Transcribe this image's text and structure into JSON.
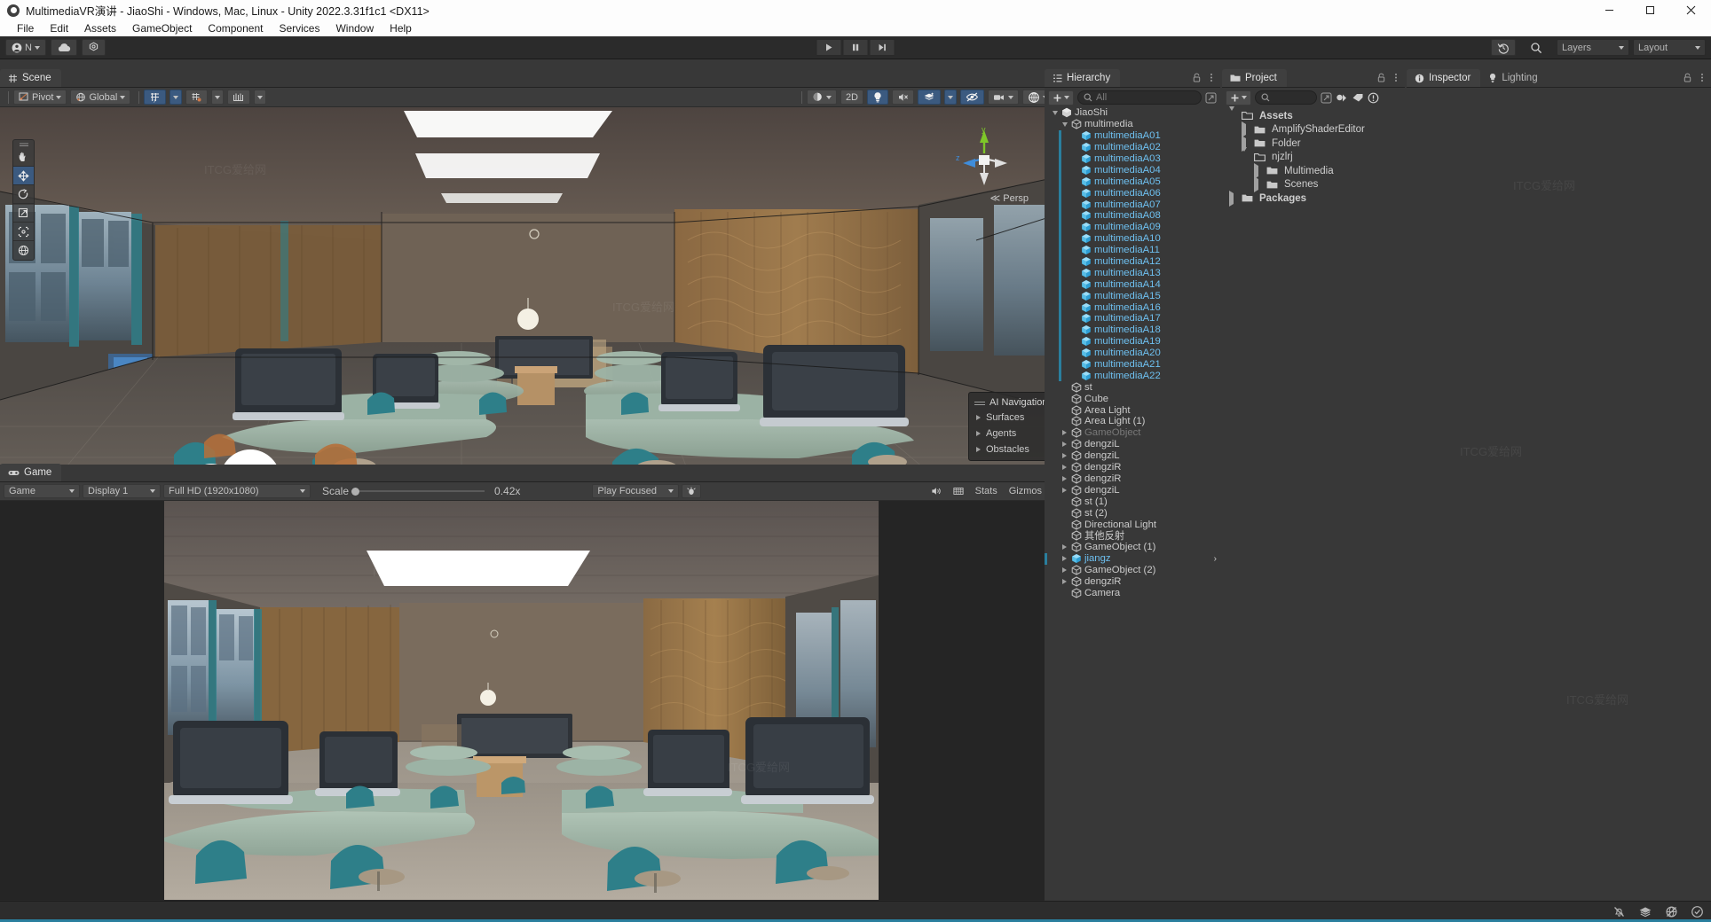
{
  "window": {
    "title": "MultimediaVR演讲 - JiaoShi - Windows, Mac, Linux - Unity 2022.3.31f1c1 <DX11>",
    "minimize": "–",
    "maximize": "□",
    "close": "✕"
  },
  "menubar": {
    "items": [
      "File",
      "Edit",
      "Assets",
      "GameObject",
      "Component",
      "Services",
      "Window",
      "Help"
    ]
  },
  "main_toolbar": {
    "account_label": "N",
    "cloud_icon": "cloud-icon",
    "settings_icon": "gear-icon",
    "play_icon": "play-icon",
    "pause_icon": "pause-icon",
    "step_icon": "step-icon",
    "history_icon": "undo-history-icon",
    "search_icon": "search-icon",
    "layers_label": "Layers",
    "layout_label": "Layout"
  },
  "scene_panel": {
    "tab_label": "Scene",
    "tab_icon": "grid-hash-icon",
    "pivot_label": "Pivot",
    "global_label": "Global",
    "grid_icon": "grid-snap-icon",
    "snap_icon": "snap-increment-icon",
    "layers_icon": "layer-bars-icon",
    "shading_icon": "shading-mode-icon",
    "twod_label": "2D",
    "lighting_icon": "light-bulb-icon",
    "audio_icon": "audio-mute-icon",
    "fx_icon": "effects-icon",
    "hidden_icon": "visibility-off-icon",
    "camera_icon": "scene-camera-icon",
    "gizmos_icon": "gizmos-icon",
    "persp_label": "Persp",
    "axis_x": "x",
    "axis_y": "y",
    "axis_z": "z",
    "tools": [
      {
        "name": "hand-tool",
        "selected": false
      },
      {
        "name": "move-tool",
        "selected": true
      },
      {
        "name": "rotate-tool",
        "selected": false
      },
      {
        "name": "scale-tool",
        "selected": false
      },
      {
        "name": "rect-tool",
        "selected": false
      },
      {
        "name": "transform-tool",
        "selected": false
      }
    ],
    "ai_navigation": {
      "title": "AI Navigation",
      "items": [
        "Surfaces",
        "Agents",
        "Obstacles"
      ]
    }
  },
  "game_panel": {
    "tab_label": "Game",
    "tab_icon": "gamepad-icon",
    "mode_label": "Game",
    "display_label": "Display 1",
    "resolution_label": "Full HD (1920x1080)",
    "scale_label": "Scale",
    "scale_value": "0.42x",
    "play_mode_label": "Play Focused",
    "bug_icon": "mute-audio-bug-icon",
    "audio_icon": "speaker-icon",
    "grid_icon": "aspect-grid-icon",
    "stats_label": "Stats",
    "gizmos_label": "Gizmos"
  },
  "hierarchy": {
    "tab_label": "Hierarchy",
    "tab_icon": "hierarchy-icon",
    "search_placeholder": "All",
    "add_icon": "plus-icon",
    "items": [
      {
        "label": "JiaoShi",
        "depth": 0,
        "icon": "unity-scene-icon",
        "twisty": "down",
        "kind": "scene"
      },
      {
        "label": "multimedia",
        "depth": 1,
        "icon": "gameobject-icon",
        "twisty": "down",
        "kind": "normal"
      },
      {
        "label": "multimediaA01",
        "depth": 2,
        "icon": "prefab-icon",
        "twisty": "none",
        "kind": "prefab"
      },
      {
        "label": "multimediaA02",
        "depth": 2,
        "icon": "prefab-icon",
        "twisty": "none",
        "kind": "prefab"
      },
      {
        "label": "multimediaA03",
        "depth": 2,
        "icon": "prefab-icon",
        "twisty": "none",
        "kind": "prefab"
      },
      {
        "label": "multimediaA04",
        "depth": 2,
        "icon": "prefab-icon",
        "twisty": "none",
        "kind": "prefab"
      },
      {
        "label": "multimediaA05",
        "depth": 2,
        "icon": "prefab-icon",
        "twisty": "none",
        "kind": "prefab"
      },
      {
        "label": "multimediaA06",
        "depth": 2,
        "icon": "prefab-icon",
        "twisty": "none",
        "kind": "prefab"
      },
      {
        "label": "multimediaA07",
        "depth": 2,
        "icon": "prefab-icon",
        "twisty": "none",
        "kind": "prefab"
      },
      {
        "label": "multimediaA08",
        "depth": 2,
        "icon": "prefab-icon",
        "twisty": "none",
        "kind": "prefab"
      },
      {
        "label": "multimediaA09",
        "depth": 2,
        "icon": "prefab-icon",
        "twisty": "none",
        "kind": "prefab"
      },
      {
        "label": "multimediaA10",
        "depth": 2,
        "icon": "prefab-icon",
        "twisty": "none",
        "kind": "prefab"
      },
      {
        "label": "multimediaA11",
        "depth": 2,
        "icon": "prefab-icon",
        "twisty": "none",
        "kind": "prefab"
      },
      {
        "label": "multimediaA12",
        "depth": 2,
        "icon": "prefab-icon",
        "twisty": "none",
        "kind": "prefab"
      },
      {
        "label": "multimediaA13",
        "depth": 2,
        "icon": "prefab-icon",
        "twisty": "none",
        "kind": "prefab"
      },
      {
        "label": "multimediaA14",
        "depth": 2,
        "icon": "prefab-icon",
        "twisty": "none",
        "kind": "prefab"
      },
      {
        "label": "multimediaA15",
        "depth": 2,
        "icon": "prefab-icon",
        "twisty": "none",
        "kind": "prefab"
      },
      {
        "label": "multimediaA16",
        "depth": 2,
        "icon": "prefab-icon",
        "twisty": "none",
        "kind": "prefab"
      },
      {
        "label": "multimediaA17",
        "depth": 2,
        "icon": "prefab-icon",
        "twisty": "none",
        "kind": "prefab"
      },
      {
        "label": "multimediaA18",
        "depth": 2,
        "icon": "prefab-icon",
        "twisty": "none",
        "kind": "prefab"
      },
      {
        "label": "multimediaA19",
        "depth": 2,
        "icon": "prefab-icon",
        "twisty": "none",
        "kind": "prefab"
      },
      {
        "label": "multimediaA20",
        "depth": 2,
        "icon": "prefab-icon",
        "twisty": "none",
        "kind": "prefab"
      },
      {
        "label": "multimediaA21",
        "depth": 2,
        "icon": "prefab-icon",
        "twisty": "none",
        "kind": "prefab"
      },
      {
        "label": "multimediaA22",
        "depth": 2,
        "icon": "prefab-icon",
        "twisty": "none",
        "kind": "prefab"
      },
      {
        "label": "st",
        "depth": 1,
        "icon": "gameobject-icon",
        "twisty": "none",
        "kind": "normal"
      },
      {
        "label": "Cube",
        "depth": 1,
        "icon": "gameobject-icon",
        "twisty": "none",
        "kind": "normal"
      },
      {
        "label": "Area Light",
        "depth": 1,
        "icon": "gameobject-icon",
        "twisty": "none",
        "kind": "normal"
      },
      {
        "label": "Area Light (1)",
        "depth": 1,
        "icon": "gameobject-icon",
        "twisty": "none",
        "kind": "normal"
      },
      {
        "label": "GameObject",
        "depth": 1,
        "icon": "gameobject-icon",
        "twisty": "right",
        "kind": "disabled"
      },
      {
        "label": "dengziL",
        "depth": 1,
        "icon": "gameobject-icon",
        "twisty": "right",
        "kind": "normal"
      },
      {
        "label": "dengziL",
        "depth": 1,
        "icon": "gameobject-icon",
        "twisty": "right",
        "kind": "normal"
      },
      {
        "label": "dengziR",
        "depth": 1,
        "icon": "gameobject-icon",
        "twisty": "right",
        "kind": "normal"
      },
      {
        "label": "dengziR",
        "depth": 1,
        "icon": "gameobject-icon",
        "twisty": "right",
        "kind": "normal"
      },
      {
        "label": "dengziL",
        "depth": 1,
        "icon": "gameobject-icon",
        "twisty": "right",
        "kind": "normal"
      },
      {
        "label": "st (1)",
        "depth": 1,
        "icon": "gameobject-icon",
        "twisty": "none",
        "kind": "normal"
      },
      {
        "label": "st (2)",
        "depth": 1,
        "icon": "gameobject-icon",
        "twisty": "none",
        "kind": "normal"
      },
      {
        "label": "Directional Light",
        "depth": 1,
        "icon": "gameobject-icon",
        "twisty": "none",
        "kind": "normal"
      },
      {
        "label": "其他反射",
        "depth": 1,
        "icon": "gameobject-icon",
        "twisty": "none",
        "kind": "normal"
      },
      {
        "label": "GameObject (1)",
        "depth": 1,
        "icon": "gameobject-icon",
        "twisty": "right",
        "kind": "normal"
      },
      {
        "label": "jiangz",
        "depth": 1,
        "icon": "prefab-icon",
        "twisty": "right",
        "kind": "prefab"
      },
      {
        "label": "GameObject (2)",
        "depth": 1,
        "icon": "gameobject-icon",
        "twisty": "right",
        "kind": "normal"
      },
      {
        "label": "dengziR",
        "depth": 1,
        "icon": "gameobject-icon",
        "twisty": "right",
        "kind": "normal"
      },
      {
        "label": "Camera",
        "depth": 1,
        "icon": "gameobject-icon",
        "twisty": "none",
        "kind": "normal"
      }
    ]
  },
  "project": {
    "tab_label": "Project",
    "tab_icon": "folder-icon",
    "search_placeholder": "",
    "add_icon": "plus-icon",
    "filter_icon": "asset-filter-icon",
    "label_icon": "label-tag-icon",
    "warning_icon": "warning-circle-icon",
    "items": [
      {
        "label": "Assets",
        "depth": 0,
        "twisty": "down",
        "open": true
      },
      {
        "label": "AmplifyShaderEditor",
        "depth": 1,
        "twisty": "right",
        "open": false
      },
      {
        "label": "Folder",
        "depth": 1,
        "twisty": "right",
        "open": false
      },
      {
        "label": "njzlrj",
        "depth": 1,
        "twisty": "down",
        "open": true
      },
      {
        "label": "Multimedia",
        "depth": 2,
        "twisty": "right",
        "open": false
      },
      {
        "label": "Scenes",
        "depth": 2,
        "twisty": "right",
        "open": false
      },
      {
        "label": "Packages",
        "depth": 0,
        "twisty": "right",
        "open": false
      }
    ]
  },
  "inspector": {
    "tab_label": "Inspector",
    "tab_icon": "info-icon",
    "lighting_tab_label": "Lighting",
    "lighting_tab_icon": "light-bulb-icon"
  },
  "statusbar": {
    "icons": [
      "mute-bell-icon",
      "layers-stack-icon",
      "no-preview-icon",
      "check-circle-icon"
    ]
  },
  "colors": {
    "accent_blue": "#2a7f9e",
    "selection_blue": "#3b5a80",
    "prefab_text": "#6ec0f0",
    "panel_bg": "#383838",
    "toolbar_bg": "#3c3c3c",
    "title_bg": "#fdfdfd"
  },
  "watermark": "ITCG爱给网"
}
